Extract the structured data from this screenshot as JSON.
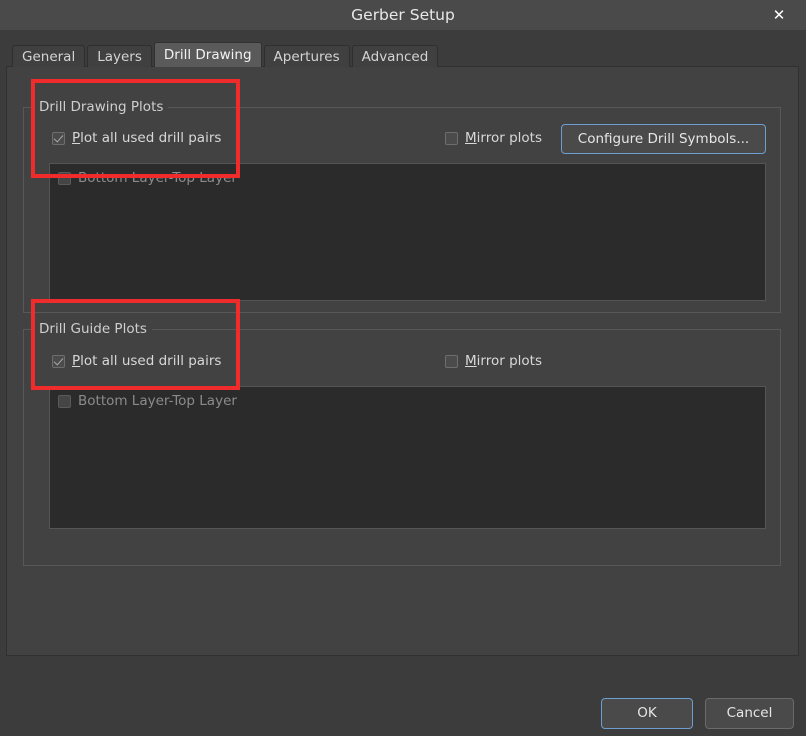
{
  "window": {
    "title": "Gerber Setup",
    "close_icon": "close-icon",
    "close_glyph": "✕"
  },
  "tabs": [
    {
      "label": "General",
      "selected": false
    },
    {
      "label": "Layers",
      "selected": false
    },
    {
      "label": "Drill Drawing",
      "selected": true
    },
    {
      "label": "Apertures",
      "selected": false
    },
    {
      "label": "Advanced",
      "selected": false
    }
  ],
  "groups": [
    {
      "title": "Drill Drawing Plots",
      "plot_all": {
        "label_mnemonic": "P",
        "label_rest": "lot all used drill pairs",
        "checked": true
      },
      "mirror": {
        "label_mnemonic": "M",
        "label_rest": "irror plots",
        "checked": false
      },
      "configure_button": {
        "label": "Configure Drill Symbols...",
        "focused": true
      },
      "list_items": [
        {
          "label": "Bottom Layer-Top Layer",
          "checked": false,
          "disabled": true
        }
      ]
    },
    {
      "title": "Drill Guide Plots",
      "plot_all": {
        "label_mnemonic": "P",
        "label_rest": "lot all used drill pairs",
        "checked": true
      },
      "mirror": {
        "label_mnemonic": "M",
        "label_rest": "irror plots",
        "checked": false
      },
      "list_items": [
        {
          "label": "Bottom Layer-Top Layer",
          "checked": false,
          "disabled": true
        }
      ]
    }
  ],
  "footer": {
    "ok_label": "OK",
    "cancel_label": "Cancel"
  },
  "colors": {
    "dialog_bg": "#3c3c3c",
    "panel_bg": "#424242",
    "listbox_bg": "#2b2b2b",
    "titlebar_bg": "#4a4a4a",
    "accent_focus": "#6e9ecf",
    "annotation_red": "#ef2b2b",
    "text": "#d6d6d6",
    "text_disabled": "#8b8b8b"
  },
  "annotations": [
    {
      "name": "highlight-drill-drawing-plots"
    },
    {
      "name": "highlight-drill-guide-plots"
    }
  ]
}
